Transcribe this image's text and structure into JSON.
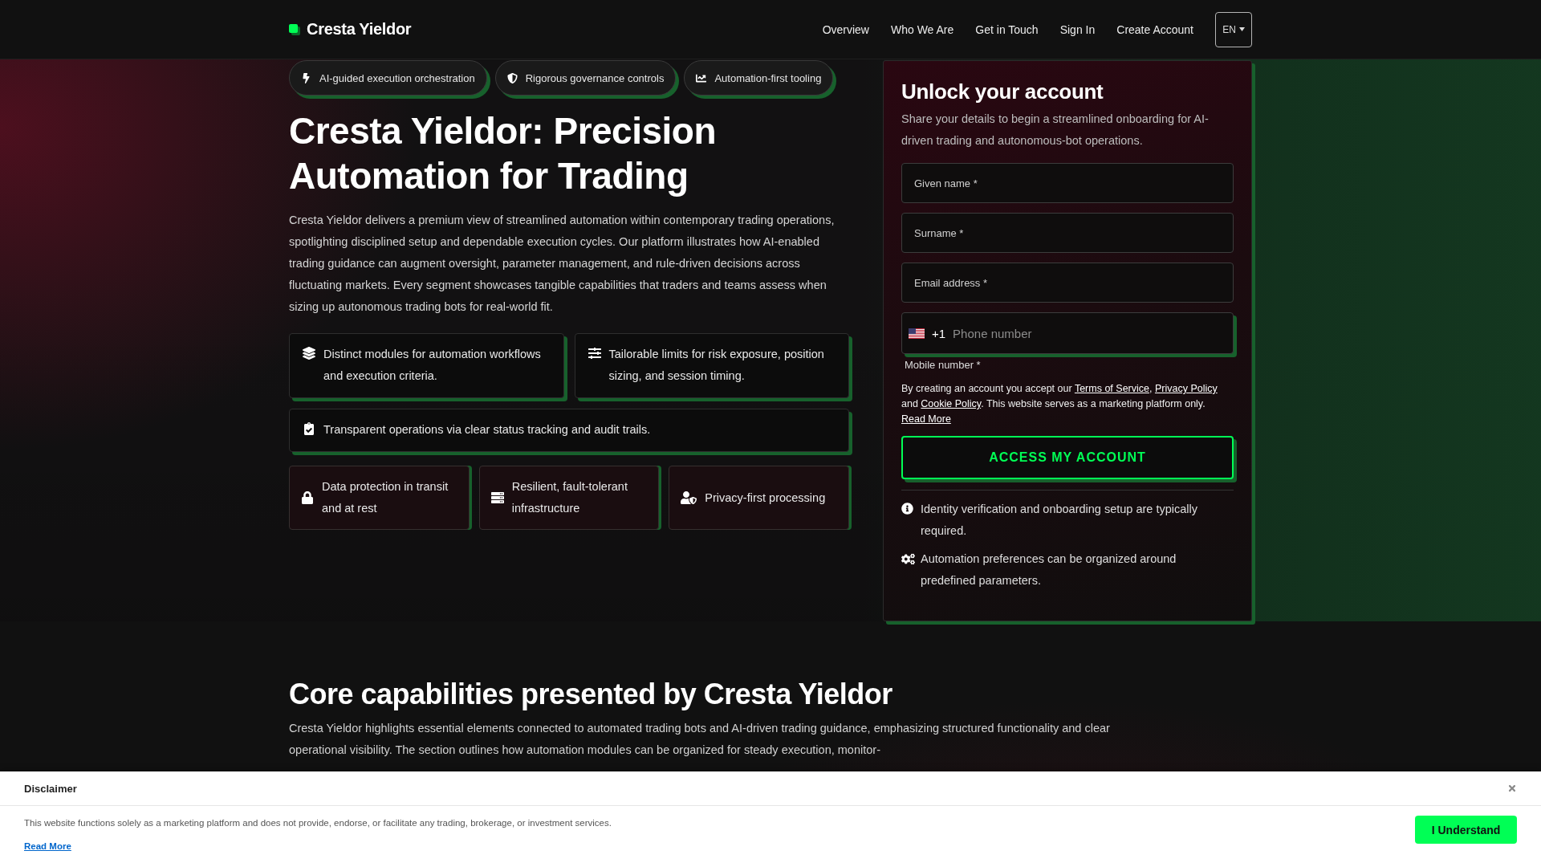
{
  "header": {
    "logo": "Cresta Yieldor",
    "nav": [
      "Overview",
      "Who We Are",
      "Get in Touch",
      "Sign In",
      "Create Account"
    ],
    "language": "EN"
  },
  "hero": {
    "badges": [
      "AI-guided execution orchestration",
      "Rigorous governance controls",
      "Automation-first tooling"
    ],
    "title": "Cresta Yieldor: Precision Automation for Trading",
    "lead": "Cresta Yieldor delivers a premium view of streamlined automation within contemporary trading operations, spotlighting disciplined setup and dependable execution cycles. Our platform illustrates how AI-enabled trading guidance can augment oversight, parameter management, and rule-driven decisions across fluctuating markets. Every segment showcases tangible capabilities that traders and teams assess when sizing up autonomous trading bots for real-world fit.",
    "features": [
      "Distinct modules for automation workflows and execution criteria.",
      "Tailorable limits for risk exposure, position sizing, and session timing.",
      "Transparent operations via clear status tracking and audit trails."
    ],
    "assurances": [
      "Data protection in transit and at rest",
      "Resilient, fault-tolerant infrastructure",
      "Privacy-first processing"
    ]
  },
  "signup": {
    "title": "Unlock your account",
    "subtitle": "Share your details to begin a streamlined onboarding for AI-driven trading and autonomous-bot operations.",
    "fields": [
      {
        "kind": "text",
        "placeholder": "Given name *"
      },
      {
        "kind": "text",
        "placeholder": "Surname *"
      },
      {
        "kind": "text",
        "placeholder": "Email address *"
      },
      {
        "kind": "phone",
        "dial_code": "+1",
        "placeholder": "Phone number",
        "label": "Mobile number *"
      }
    ],
    "consent": [
      {
        "kind": "text",
        "text": "By creating an account you accept our "
      },
      {
        "kind": "link",
        "text": "Terms of Service"
      },
      {
        "kind": "text",
        "text": ", "
      },
      {
        "kind": "link",
        "text": "Privacy Policy"
      },
      {
        "kind": "text",
        "text": " and "
      },
      {
        "kind": "link",
        "text": "Cookie Policy"
      },
      {
        "kind": "text",
        "text": ". This website serves as a marketing platform only. "
      },
      {
        "kind": "link",
        "text": "Read More"
      }
    ],
    "submit": "ACCESS MY ACCOUNT",
    "notes": [
      "Identity verification and onboarding setup are typically required.",
      "Automation preferences can be organized around predefined parameters."
    ]
  },
  "core": {
    "title": "Core capabilities presented by Cresta Yieldor",
    "text": "Cresta Yieldor highlights essential elements connected to automated trading bots and AI-driven trading guidance, emphasizing structured functionality and clear operational visibility. The section outlines how automation modules can be organized for steady execution, monitor-"
  },
  "disclaimer": {
    "title": "Disclaimer",
    "text": "This website functions solely as a marketing platform and does not provide, endorse, or facilitate any trading, brokerage, or investment services.",
    "link": "Read More",
    "button": "I Understand"
  }
}
